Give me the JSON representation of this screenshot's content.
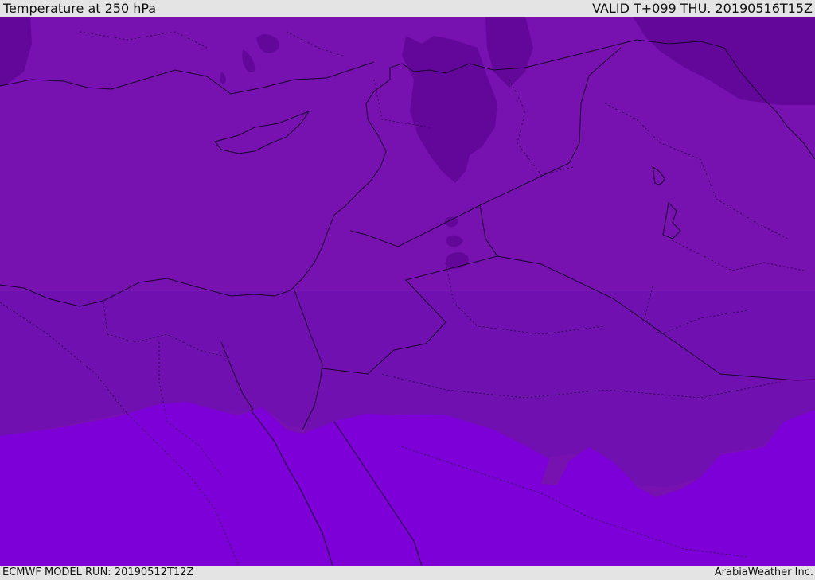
{
  "header": {
    "title": "Temperature at 250 hPa",
    "valid": "VALID T+099 THU. 20190516T15Z"
  },
  "footer": {
    "model_run": "ECMWF MODEL RUN: 20190512T12Z",
    "credit": "ArabiaWeather Inc."
  },
  "map": {
    "colors": {
      "base": "#7711b0",
      "cold": "#63069a",
      "mid": "#7010b0",
      "warm": "#7d00d8",
      "coast": "#1a0030"
    }
  }
}
